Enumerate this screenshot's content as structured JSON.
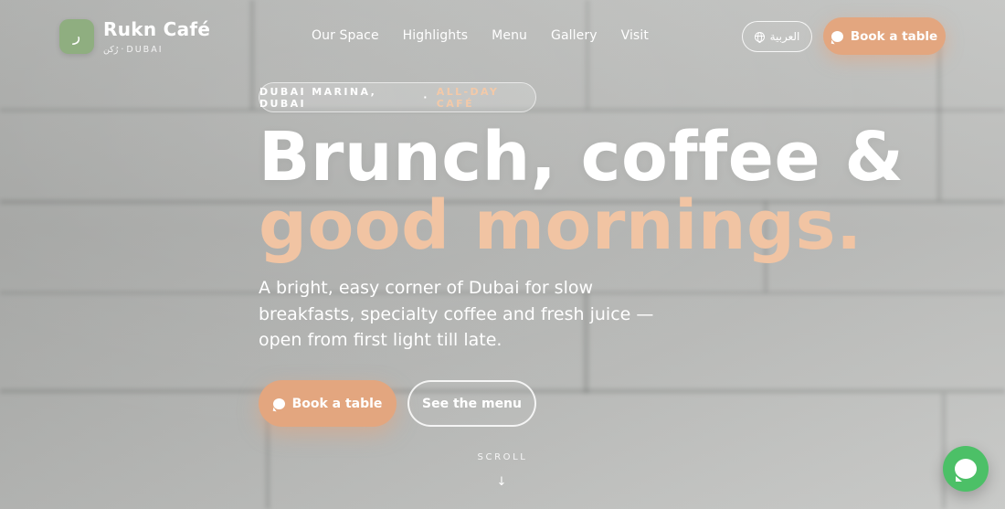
{
  "brand": {
    "logo_glyph": "ر",
    "name": "Rukn Café",
    "subtitle": "رُكن · DUBAI"
  },
  "nav": {
    "items": [
      {
        "label": "Our Space"
      },
      {
        "label": "Highlights"
      },
      {
        "label": "Menu"
      },
      {
        "label": "Gallery"
      },
      {
        "label": "Visit"
      }
    ]
  },
  "header": {
    "language_label": "العربية",
    "language_icon": "globe-icon",
    "book_label": "Book a table",
    "book_icon": "chat-bubble-icon"
  },
  "hero": {
    "eyebrow_location": "DUBAI MARINA, DUBAI",
    "eyebrow_separator": "·",
    "eyebrow_accent": "ALL-DAY CAFÉ",
    "headline": "Brunch, coffee &",
    "headline_accent": "good mornings.",
    "lede": "A bright, easy corner of Dubai for slow breakfasts, specialty coffee and fresh juice — open from first light till late.",
    "cta_primary": "Book a table",
    "cta_secondary": "See the menu",
    "scroll_label": "SCROLL",
    "scroll_arrow": "↓"
  },
  "chat": {
    "icon": "whatsapp-icon"
  },
  "colors": {
    "accent": "#e3a67f",
    "accent_text": "#f1c4a3",
    "logo_bg": "#8fae80",
    "chat_bg": "#4cc067"
  }
}
